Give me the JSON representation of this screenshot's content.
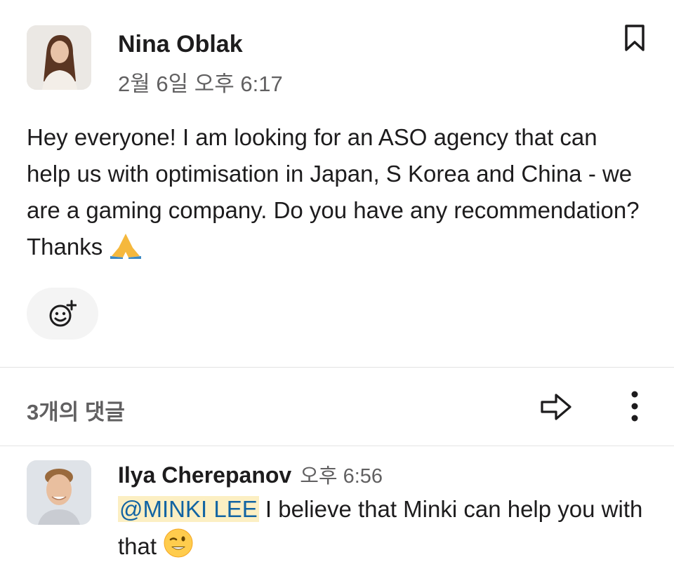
{
  "post": {
    "author": "Nina Oblak",
    "timestamp": "2월 6일 오후 6:17",
    "message": "Hey everyone! I am looking for an ASO agency that can help us with optimisation in Japan, S Korea and China - we are a gaming company. Do you have any recommendation? Thanks",
    "message_emoji": "folded-hands-emoji"
  },
  "icons": {
    "bookmark": "bookmark-icon",
    "add_reaction": "add-reaction-icon",
    "share": "share-arrow-icon",
    "more": "more-vertical-icon"
  },
  "thread": {
    "replies_label": "3개의 댓글"
  },
  "reply": {
    "author": "Ilya Cherepanov",
    "time": "오후 6:56",
    "mention": "@MINKI LEE",
    "text_after_mention": " I believe that Minki can help you with that",
    "emoji": "winking-face-emoji"
  },
  "colors": {
    "mention_bg": "#fcefc3",
    "mention_text": "#1264a3",
    "secondary_text": "#616061"
  }
}
